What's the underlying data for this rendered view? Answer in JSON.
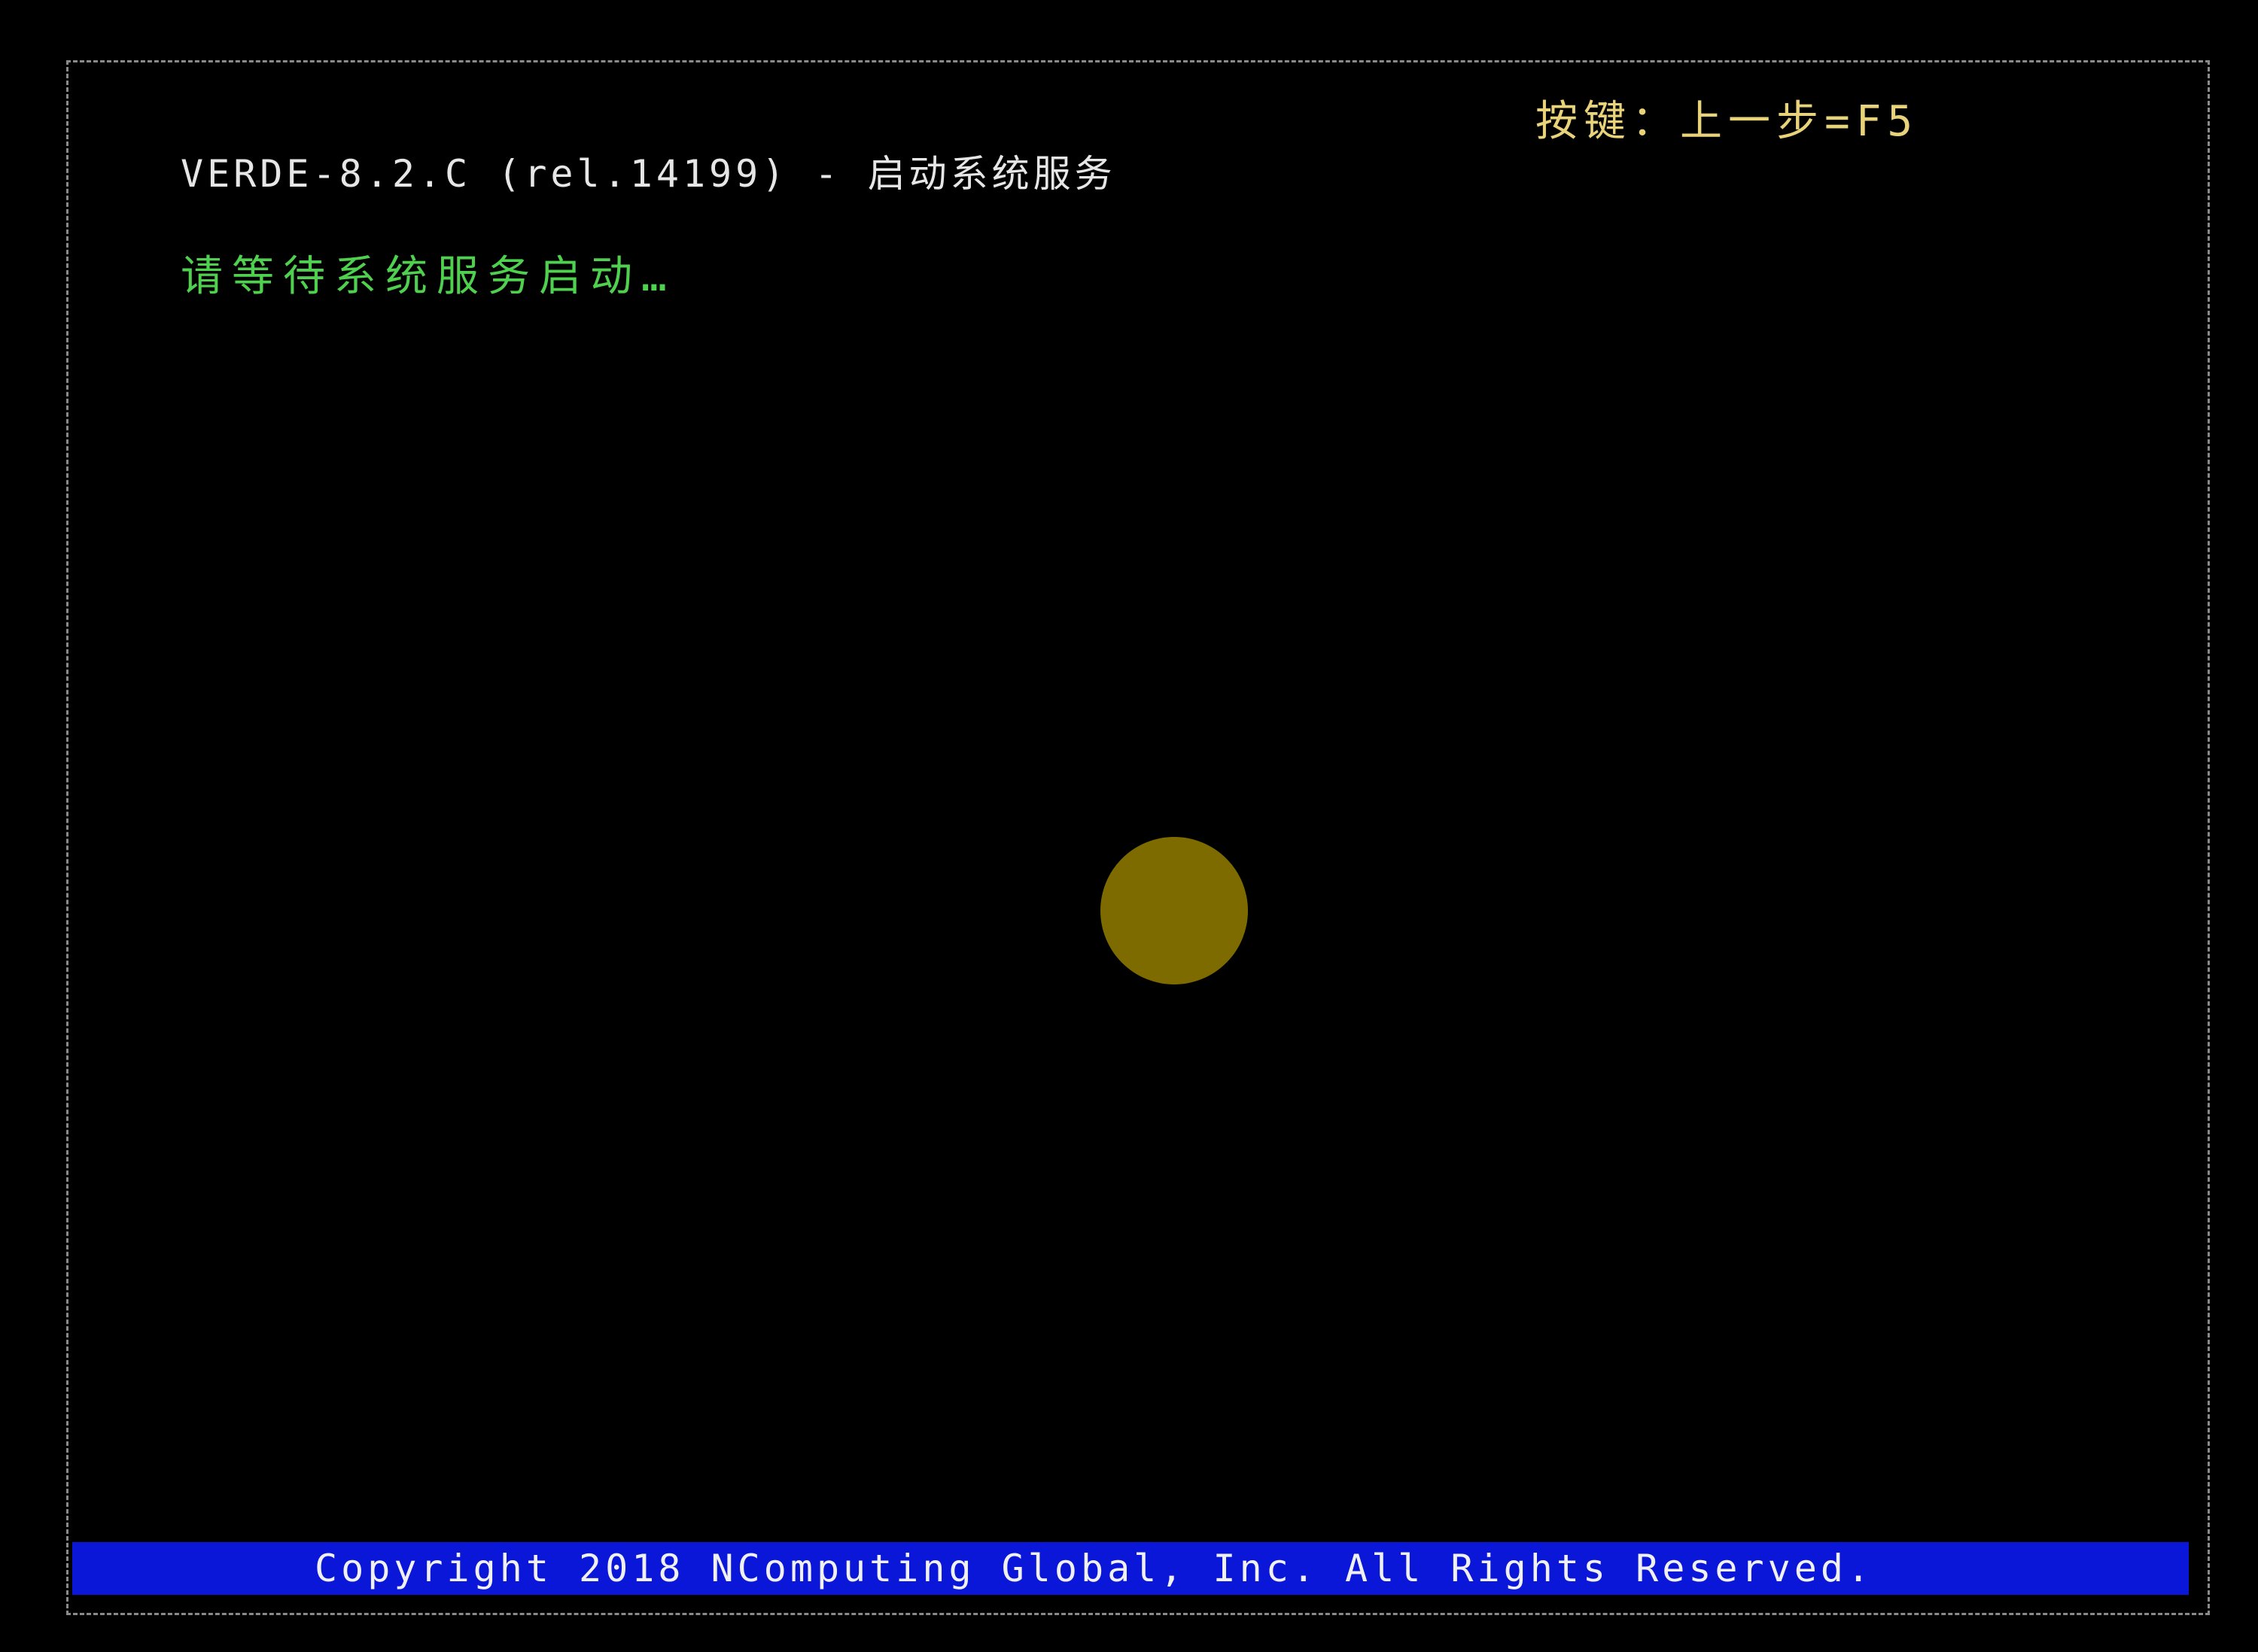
{
  "header": {
    "title": "VERDE-8.2.C (rel.14199) - 启动系统服务",
    "key_hint": "按键：上一步=F5"
  },
  "main": {
    "status_message": "请等待系统服务启动…",
    "spinner_icon": "loading-spinner-icon"
  },
  "footer": {
    "copyright": "Copyright 2018 NComputing Global, Inc.  All Rights Reserved."
  },
  "colors": {
    "background": "#000000",
    "title": "#e6e6e6",
    "key_hint": "#e8d27a",
    "status": "#4fd04f",
    "spinner": "#7d6b00",
    "footer_bar": "#0a16d8",
    "frame": "#8a8a8a"
  }
}
